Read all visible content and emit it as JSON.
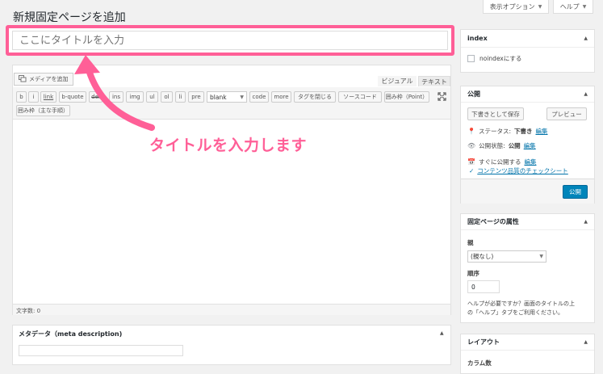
{
  "page": {
    "title": "新規固定ページを追加"
  },
  "top_buttons": {
    "screen_options": "表示オプション",
    "help": "ヘルプ"
  },
  "title_field": {
    "placeholder": "ここにタイトルを入力"
  },
  "editor": {
    "add_media": "メディアを追加",
    "tab_visual": "ビジュアル",
    "tab_text": "テキスト",
    "quicktags_row1": [
      "b",
      "i",
      "link",
      "b-quote",
      "del",
      "ins",
      "img",
      "ul",
      "ol",
      "li",
      "pre"
    ],
    "format_select": "blank",
    "quicktags_row1b": [
      "code",
      "more",
      "タグを閉じる",
      "ソースコード",
      "囲み枠（Point）"
    ],
    "quicktags_row2": [
      "囲み枠（主な手順）"
    ],
    "word_count": "文字数: 0"
  },
  "meta_box": {
    "title": "メタデータ（meta description)"
  },
  "annotation": {
    "text": "タイトルを入力します"
  },
  "sidebar": {
    "index_box": {
      "title": "index",
      "checkbox_label": "noindexにする"
    },
    "publish_box": {
      "title": "公開",
      "save_draft": "下書きとして保存",
      "preview": "プレビュー",
      "status_label": "ステータス:",
      "status_value": "下書き",
      "status_edit": "編集",
      "visibility_label": "公開状態:",
      "visibility_value": "公開",
      "visibility_edit": "編集",
      "schedule_value": "すぐに公開する",
      "schedule_edit": "編集",
      "content_check": "コンテンツ品質のチェックシート",
      "publish": "公開"
    },
    "attributes_box": {
      "title": "固定ページの属性",
      "parent_label": "親",
      "parent_value": "(親なし)",
      "order_label": "順序",
      "order_value": "0",
      "help_text_1": "ヘルプが必要ですか？画面のタイトルの上",
      "help_text_2": "の「ヘルプ」タブをご利用ください。"
    },
    "layout_box": {
      "title": "レイアウト",
      "columns_label": "カラム数"
    }
  },
  "colors": {
    "accent_pink": "#ff5f97",
    "publish_blue": "#0085ba",
    "link_blue": "#0073aa"
  },
  "icons": [
    "media-icon",
    "fullscreen-icon",
    "pin-icon",
    "eye-icon",
    "calendar-icon",
    "check-icon",
    "arrow-annotation"
  ]
}
